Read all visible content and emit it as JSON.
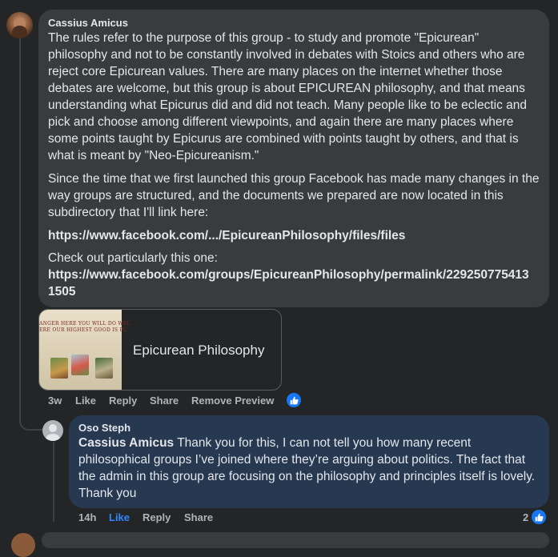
{
  "comment": {
    "author": "Cassius Amicus",
    "paragraphs": [
      "The rules refer to the purpose of this group - to study and promote \"Epicurean\" philosophy and not to be constantly involved in debates with Stoics and others who are reject core Epicurean values. There are many places on the internet whether those debates are welcome, but this group is about EPICUREAN philosophy, and that means understanding what Epicurus did and did not teach. Many people like to be eclectic and pick and choose among different viewpoints, and again there are many places where some points taught by Epicurus are combined with points taught by others, and that is what is meant by \"Neo-Epicureanism.\"",
      "Since the time that we first launched this group Facebook has made many changes in the way groups are structured, and the documents we prepared are now located in this subdirectory that I'll link here:",
      "Check out particularly this one:"
    ],
    "link1": "https://www.facebook.com/.../EpicureanPhilosophy/files/files",
    "link2_line1": "https://www.facebook.com/groups/EpicureanPhilosophy/permalink/229250775413",
    "link2_line2": "1505",
    "preview": {
      "title": "Epicurean Philosophy",
      "thumb_line1": "ANGER HERE YOU WILL DO WEL",
      "thumb_line2": "ERE OUR HIGHEST GOOD IS PL"
    },
    "actions": {
      "time": "3w",
      "like": "Like",
      "reply": "Reply",
      "share": "Share",
      "remove_preview": "Remove Preview"
    }
  },
  "reply": {
    "author": "Oso Steph",
    "mention": "Cassius Amicus",
    "text": " Thank you for this, I can not tell you how many recent philosophical groups I’ve joined where they’re arguing about politics. The fact that the admin in this group are focusing on the philosophy and principles itself is lovely. Thank you",
    "actions": {
      "time": "14h",
      "like": "Like",
      "reply": "Reply",
      "share": "Share"
    },
    "reaction_count": "2"
  },
  "colors": {
    "background": "#242526",
    "bubble": "#3a3b3c",
    "reply_bubble": "#263951",
    "like_blue": "#1877f2",
    "active_like": "#2d88ff"
  },
  "icons": [
    "like-reaction-icon",
    "thumbs-up-icon",
    "default-avatar-icon"
  ]
}
